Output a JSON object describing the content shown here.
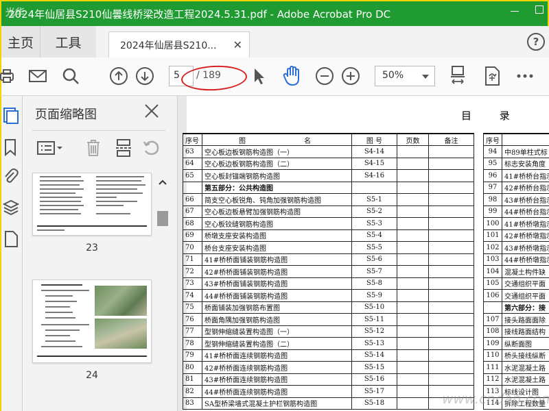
{
  "window": {
    "title": "2024年仙居县S210仙曇线桥梁改造工程2024.5.31.pdf - Adobe Acrobat Pro DC"
  },
  "nav": {
    "home_label": "主页",
    "tools_label": "工具",
    "doc_tab_label": "2024年仙居县S210...",
    "help_label": "?"
  },
  "toolbar": {
    "page_current": "5",
    "page_total": "/ 189",
    "zoom_value": "50%"
  },
  "thumbnails": {
    "panel_title": "页面缩略图",
    "pages": [
      {
        "label": "23"
      },
      {
        "label": "24"
      }
    ]
  },
  "document": {
    "heading": "目 录",
    "table_headers": [
      "序号",
      "图",
      "名",
      "图 号",
      "页数",
      "备注"
    ],
    "rows": [
      {
        "no": "63",
        "name": "空心板边板钢筋构造图（一）",
        "fig": "S4-14"
      },
      {
        "no": "64",
        "name": "空心板边板钢筋构造图（二）",
        "fig": "S4-15"
      },
      {
        "no": "65",
        "name": "空心板封锚端钢筋构造图",
        "fig": "S4-16"
      },
      {
        "no": "",
        "name": "第五部分：公共构造图",
        "fig": "",
        "section": true
      },
      {
        "no": "66",
        "name": "简支空心板锐角、钝角加强钢筋构造图",
        "fig": "S5-1"
      },
      {
        "no": "67",
        "name": "空心板边板悬臂加强钢筋构造图",
        "fig": "S5-2"
      },
      {
        "no": "68",
        "name": "空心板铰缝钢筋构造图",
        "fig": "S5-3"
      },
      {
        "no": "69",
        "name": "桥墩支座安装构造图",
        "fig": "S5-4"
      },
      {
        "no": "70",
        "name": "桥台支座安装构造图",
        "fig": "S5-5"
      },
      {
        "no": "71",
        "name": "41#桥桥面铺装钢筋构造图",
        "fig": "S5-6"
      },
      {
        "no": "72",
        "name": "42#桥桥面铺装钢筋构造图",
        "fig": "S5-7"
      },
      {
        "no": "73",
        "name": "43#桥桥面铺装钢筋构造图",
        "fig": "S5-8"
      },
      {
        "no": "74",
        "name": "44#桥桥面铺装钢筋构造图",
        "fig": "S5-9"
      },
      {
        "no": "75",
        "name": "桥面铺装加强钢筋布置图",
        "fig": "S5-10"
      },
      {
        "no": "76",
        "name": "桥面角隅加强钢筋构造图",
        "fig": "S5-11"
      },
      {
        "no": "77",
        "name": "型钢伸缩缝装置构造图（一）",
        "fig": "S5-12"
      },
      {
        "no": "78",
        "name": "型钢伸缩缝装置构造图（二）",
        "fig": "S5-13"
      },
      {
        "no": "79",
        "name": "41#桥桥面连续钢筋构造图",
        "fig": "S5-14"
      },
      {
        "no": "80",
        "name": "42#桥桥面连续钢筋构造图",
        "fig": "S5-15"
      },
      {
        "no": "81",
        "name": "43#桥桥面连续钢筋构造图",
        "fig": "S5-16"
      },
      {
        "no": "82",
        "name": "44#桥桥面连续钢筋构造图",
        "fig": "S5-17"
      },
      {
        "no": "83",
        "name": "SA型桥梁墙式混凝土护栏钢筋构造图",
        "fig": "S5-18"
      }
    ],
    "right_header_no": "序号",
    "right_rows": [
      {
        "no": "94",
        "name": "中89单柱式标"
      },
      {
        "no": "95",
        "name": "标志安装角度"
      },
      {
        "no": "96",
        "name": "41#桥桥台指示"
      },
      {
        "no": "97",
        "name": "42#桥桥台指示"
      },
      {
        "no": "98",
        "name": "43#桥桥台指示"
      },
      {
        "no": "99",
        "name": "44#桥桥台指示"
      },
      {
        "no": "100",
        "name": "41#桥桥墩指示"
      },
      {
        "no": "101",
        "name": "42#桥桥墩指示"
      },
      {
        "no": "102",
        "name": "43#桥桥墩指示"
      },
      {
        "no": "103",
        "name": "44#桥桥墩指示"
      },
      {
        "no": "104",
        "name": "混凝土构件缺"
      },
      {
        "no": "105",
        "name": "交通组织平面"
      },
      {
        "no": "106",
        "name": "交通组织平面"
      },
      {
        "no": "",
        "name": "第六部分：接"
      },
      {
        "no": "107",
        "name": "接头路面面除"
      },
      {
        "no": "108",
        "name": "接线路面结构"
      },
      {
        "no": "109",
        "name": "纵断面图"
      },
      {
        "no": "110",
        "name": "桥头接线纵断"
      },
      {
        "no": "111",
        "name": "水泥混凝土路"
      },
      {
        "no": "112",
        "name": "水泥混凝土路"
      },
      {
        "no": "113",
        "name": "标线设计图"
      },
      {
        "no": "114",
        "name": "拆除工程数量"
      }
    ]
  },
  "watermarks": {
    "top_left": "光华",
    "bottom_right": "www.cndan.com"
  }
}
